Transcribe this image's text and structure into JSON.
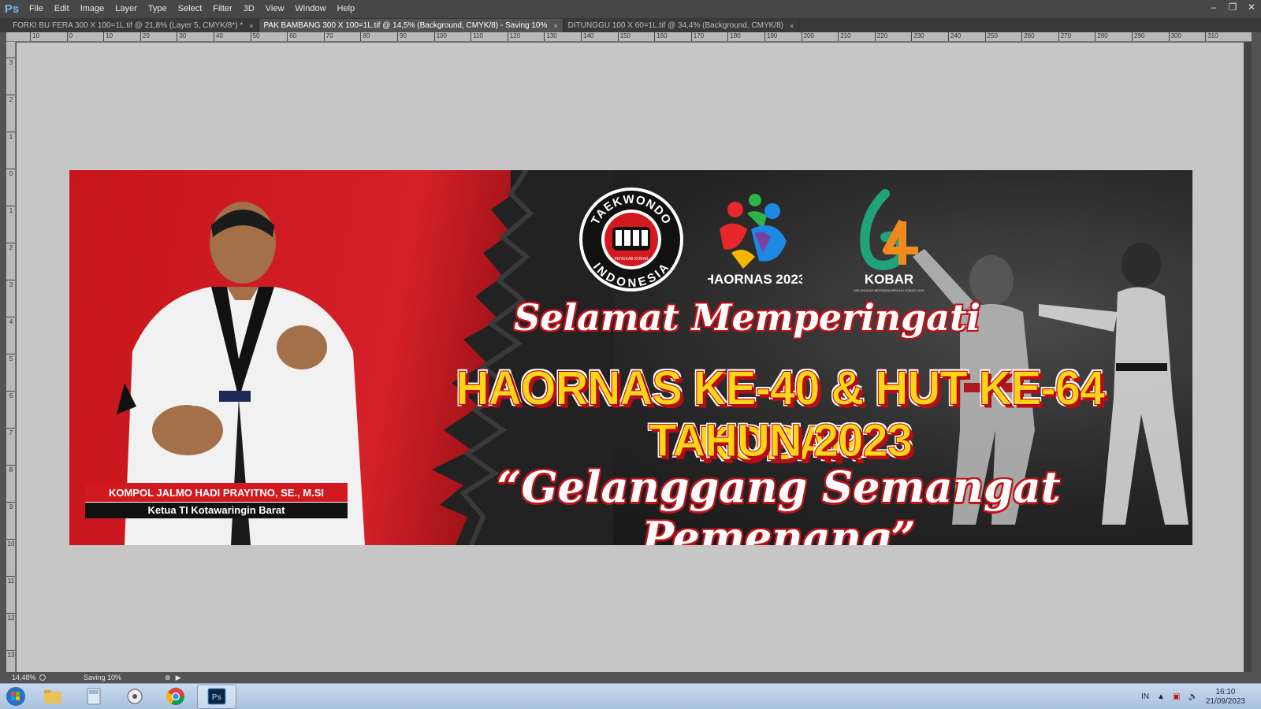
{
  "app": {
    "logo": "Ps"
  },
  "menu": [
    "File",
    "Edit",
    "Image",
    "Layer",
    "Type",
    "Select",
    "Filter",
    "3D",
    "View",
    "Window",
    "Help"
  ],
  "window_controls": {
    "minimize": "–",
    "restore": "❐",
    "close": "✕"
  },
  "tabs": [
    {
      "label": "FORKI BU FERA 300 X 100=1L.tif @ 21,8% (Layer 5, CMYK/8*) *",
      "close": "×"
    },
    {
      "label": "PAK BAMBANG 300 X 100=1L.tif @ 14,5% (Background, CMYK/8) - Saving 10%",
      "close": "×"
    },
    {
      "label": "DITUNGGU 100 X 60=1L.tif @ 34,4% (Background, CMYK/8)",
      "close": "×"
    }
  ],
  "ruler_top": [
    "10",
    "0",
    "10",
    "20",
    "30",
    "40",
    "50",
    "60",
    "70",
    "80",
    "90",
    "100",
    "110",
    "120",
    "130",
    "140",
    "150",
    "160",
    "170",
    "180",
    "190",
    "200",
    "210",
    "220",
    "230",
    "240",
    "250",
    "260",
    "270",
    "280",
    "290",
    "300",
    "310"
  ],
  "ruler_left": [
    "3",
    "2",
    "1",
    "0",
    "1",
    "2",
    "3",
    "4",
    "5",
    "6",
    "7",
    "8",
    "9",
    "10",
    "11",
    "12",
    "13"
  ],
  "banner": {
    "logo_tkd_top": "TAEKWONDO",
    "logo_tkd_bottom": "INDONESIA",
    "logo_tkd_small": "PENGKAB KOBAR",
    "logo_haornas_caption": "HAORNAS 2023",
    "logo_kobar_caption": "KOBAR",
    "logo_kobar_small": "MELANGKAH BERSAMA MENUJU KOBAR JAYA",
    "greeting": "Selamat Memperingati",
    "headline_1": "HAORNAS KE-40 & HUT KE-64 KOBAR",
    "headline_2": "TAHUN 2023",
    "tagline": "“Gelanggang Semangat Pemenang”",
    "person_name": "KOMPOL JALMO HADI PRAYITNO, SE., M.SI",
    "person_title": "Ketua TI Kotawaringin Barat"
  },
  "statusbar": {
    "zoom": "14,48%",
    "status": "Saving 10%"
  },
  "taskbar": {
    "lang": "IN",
    "time": "16:10",
    "date": "21/09/2023"
  },
  "colors": {
    "banner_red": "#d1191f",
    "headline_yellow": "#ffd51a"
  }
}
